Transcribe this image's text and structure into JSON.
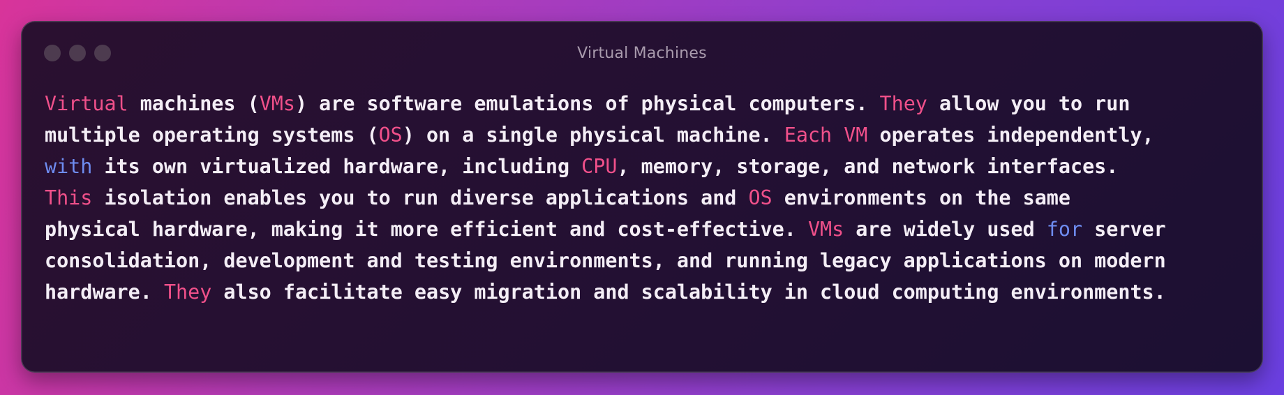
{
  "window": {
    "title": "Virtual Machines",
    "traffic_lights": [
      "close",
      "minimize",
      "zoom"
    ]
  },
  "colors": {
    "keyword_pink": "#f0508a",
    "keyword_blue": "#6e8cf0",
    "text": "#f4eef6"
  },
  "lines": [
    [
      {
        "t": "Virtual",
        "c": "pink"
      },
      {
        "t": " machines (",
        "c": ""
      },
      {
        "t": "VMs",
        "c": "pink"
      },
      {
        "t": ") are software emulations of physical computers. ",
        "c": ""
      },
      {
        "t": "They",
        "c": "pink"
      },
      {
        "t": " allow you to run",
        "c": ""
      }
    ],
    [
      {
        "t": "multiple operating systems (",
        "c": ""
      },
      {
        "t": "OS",
        "c": "pink"
      },
      {
        "t": ") on a single physical machine. ",
        "c": ""
      },
      {
        "t": "Each VM",
        "c": "pink"
      },
      {
        "t": " operates independently,",
        "c": ""
      }
    ],
    [
      {
        "t": "with",
        "c": "blue"
      },
      {
        "t": " its own virtualized hardware, including ",
        "c": ""
      },
      {
        "t": "CPU",
        "c": "pink"
      },
      {
        "t": ", memory, storage, and network interfaces.",
        "c": ""
      }
    ],
    [
      {
        "t": "This",
        "c": "pink"
      },
      {
        "t": " isolation enables you to run diverse applications and ",
        "c": ""
      },
      {
        "t": "OS",
        "c": "pink"
      },
      {
        "t": " environments on the same",
        "c": ""
      }
    ],
    [
      {
        "t": "physical hardware, making it more efficient and cost-effective. ",
        "c": ""
      },
      {
        "t": "VMs",
        "c": "pink"
      },
      {
        "t": " are widely used ",
        "c": ""
      },
      {
        "t": "for",
        "c": "blue"
      },
      {
        "t": " server",
        "c": ""
      }
    ],
    [
      {
        "t": "consolidation, development and testing environments, and running legacy applications on modern",
        "c": ""
      }
    ],
    [
      {
        "t": "hardware. ",
        "c": ""
      },
      {
        "t": "They",
        "c": "pink"
      },
      {
        "t": " also facilitate easy migration and scalability in cloud computing environments.",
        "c": ""
      }
    ]
  ]
}
